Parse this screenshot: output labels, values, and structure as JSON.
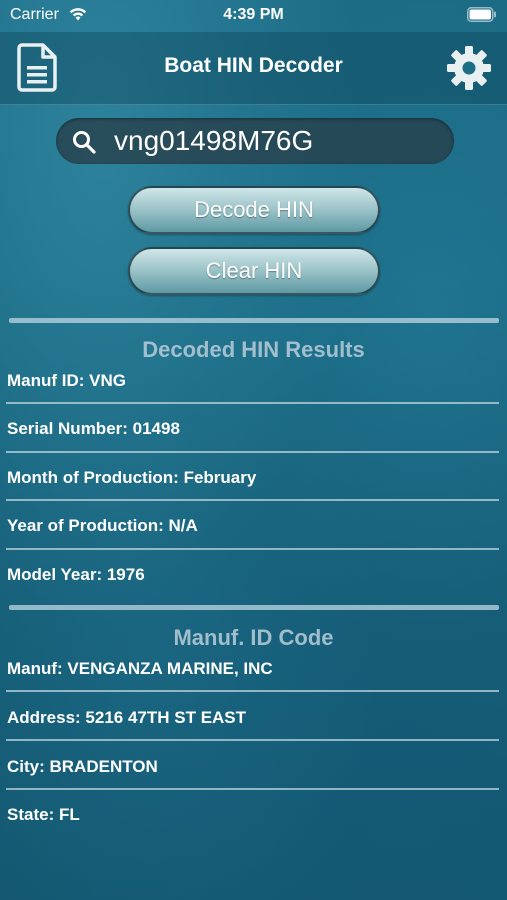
{
  "status_bar": {
    "carrier": "Carrier",
    "time": "4:39 PM"
  },
  "nav": {
    "title": "Boat HIN Decoder",
    "left_icon": "document-icon",
    "right_icon": "gear-icon"
  },
  "search": {
    "value": "vng01498M76G",
    "icon": "search-icon"
  },
  "buttons": {
    "decode_label": "Decode HIN",
    "clear_label": "Clear HIN"
  },
  "results": {
    "title": "Decoded HIN Results",
    "rows": [
      "Manuf ID: VNG",
      "Serial Number: 01498",
      "Month of Production: February",
      "Year of Production: N/A",
      "Model Year: 1976"
    ]
  },
  "manufacturer": {
    "title": "Manuf. ID Code",
    "rows": [
      "Manuf: VENGANZA MARINE, INC",
      "Address: 5216 47TH ST EAST",
      "City: BRADENTON",
      "State: FL"
    ]
  },
  "colors": {
    "background": "#1a6a83",
    "button_top": "#cfe6e8",
    "button_bottom": "#5f9aa4",
    "section_title": "#afc8d4"
  }
}
